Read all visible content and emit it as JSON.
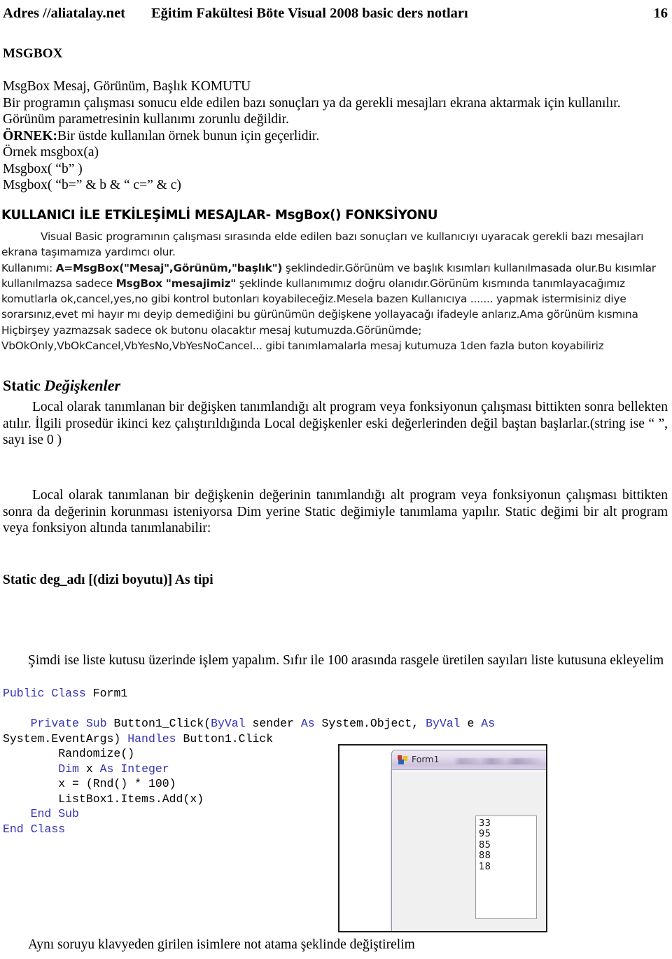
{
  "header": {
    "address": "Adres //aliatalay.net",
    "title": "Eğitim Fakültesi Böte Visual 2008 basic ders notları",
    "page_number": "16"
  },
  "msgbox_section": {
    "heading": "MSGBOX",
    "line1": "MsgBox Mesaj, Görünüm, Başlık KOMUTU",
    "line2": "Bir programın çalışması sonucu elde edilen bazı sonuçları ya da gerekli mesajları ekrana aktarmak için kullanılır.",
    "line3": "Görünüm parametresinin kullanımı zorunlu değildir.",
    "line4_bold": "ÖRNEK:",
    "line4_rest": "Bir üstde kullanılan örnek bunun için geçerlidir.",
    "line5": "Örnek msgbox(a)",
    "line6": "Msgbox( “b” )",
    "line7": "Msgbox( “b=” & b & “  c=” & c)"
  },
  "kullanici_section": {
    "heading": "KULLANICI İLE ETKİLEŞİMLİ MESAJLAR- MsgBox() FONKSİYONU",
    "p1": "Visual Basic programının çalışması sırasında elde edilen bazı sonuçları ve kullanıcıyı uyaracak gerekli bazı mesajları ekrana taşımamıza yardımcı olur.",
    "p2_pre": "Kullanımı: ",
    "p2_bold": "A=MsgBox(\"Mesaj\",Görünüm,\"başlık\")",
    "p2_mid": " şeklindedir.Görünüm ve başlık kısımları kullanılmasada olur.Bu kısımlar kullanılmazsa sadece ",
    "p2_bold2": "MsgBox \"mesajimiz\"",
    "p2_post": " şeklinde kullanımımız doğru olanıdır.Görünüm kısmında tanımlayacağımız komutlarla ok,cancel,yes,no gibi kontrol butonları koyabileceğiz.Mesela bazen Kullanıcıya ....... yapmak istermisiniz diye sorarsınız,evet mi hayır mı deyip demediğini bu gürünümün değişkene yollayacağı ifadeyle anlarız.Ama görünüm kısmına Hiçbirşey yazmazsak sadece ok butonu olacaktır mesaj kutumuzda.Görünümde; VbOkOnly,VbOkCancel,VbYesNo,VbYesNoCancel... gibi tanımlamalarla mesaj kutumuza 1den fazla buton koyabiliriz"
  },
  "static_section": {
    "heading_bold": "Static",
    "heading_italic": " Değişkenler",
    "p1": "Local olarak tanımlanan bir değişken tanımlandığı alt program veya fonksiyonun çalışması bittikten sonra bellekten atılır. İlgili prosedür ikinci kez çalıştırıldığında Local değişkenler eski değerlerinden değil baştan başlarlar.(string ise “ ”, sayı ise 0 )",
    "p2": "Local olarak tanımlanan bir değişkenin değerinin tanımlandığı alt program veya fonksiyonun çalışması bittikten sonra da değerinin korunması isteniyorsa Dim yerine Static değimiyle tanımlama yapılır. Static değimi bir alt program veya fonksiyon altında tanımlanabilir:",
    "syntax": "Static deg_adı [(dizi boyutu)] As tipi"
  },
  "liste_section": {
    "p1": "Şimdi ise liste kutusu üzerinde işlem yapalım.  Sıfır ile 100 arasında rasgele üretilen sayıları liste kutusuna ekleyelim"
  },
  "code": {
    "lines": [
      [
        {
          "t": "Public",
          "c": "kw"
        },
        {
          "t": " ",
          "c": ""
        },
        {
          "t": "Class",
          "c": "kw"
        },
        {
          "t": " Form1",
          "c": ""
        }
      ],
      [
        {
          "t": "",
          "c": ""
        }
      ],
      [
        {
          "t": "    ",
          "c": ""
        },
        {
          "t": "Private",
          "c": "kw"
        },
        {
          "t": " ",
          "c": ""
        },
        {
          "t": "Sub",
          "c": "kw"
        },
        {
          "t": " Button1_Click(",
          "c": ""
        },
        {
          "t": "ByVal",
          "c": "kw"
        },
        {
          "t": " sender ",
          "c": ""
        },
        {
          "t": "As",
          "c": "kw"
        },
        {
          "t": " System.Object, ",
          "c": ""
        },
        {
          "t": "ByVal",
          "c": "kw"
        },
        {
          "t": " e ",
          "c": ""
        },
        {
          "t": "As",
          "c": "kw"
        },
        {
          "t": " System.EventArgs) ",
          "c": ""
        },
        {
          "t": "Handles",
          "c": "kw"
        },
        {
          "t": " Button1.Click",
          "c": ""
        }
      ],
      [
        {
          "t": "        Randomize()",
          "c": ""
        }
      ],
      [
        {
          "t": "        ",
          "c": ""
        },
        {
          "t": "Dim",
          "c": "kw"
        },
        {
          "t": " x ",
          "c": ""
        },
        {
          "t": "As",
          "c": "kw"
        },
        {
          "t": " ",
          "c": ""
        },
        {
          "t": "Integer",
          "c": "kw"
        }
      ],
      [
        {
          "t": "        x = (Rnd() * 100)",
          "c": ""
        }
      ],
      [
        {
          "t": "        ListBox1.Items.Add(x)",
          "c": ""
        }
      ],
      [
        {
          "t": "    ",
          "c": ""
        },
        {
          "t": "End",
          "c": "kw"
        },
        {
          "t": " ",
          "c": ""
        },
        {
          "t": "Sub",
          "c": "kw"
        }
      ],
      [
        {
          "t": "End",
          "c": "kw"
        },
        {
          "t": " ",
          "c": ""
        },
        {
          "t": "Class",
          "c": "kw"
        }
      ]
    ]
  },
  "screenshot": {
    "form_caption": "Form1",
    "listbox_items": [
      "33",
      "95",
      "85",
      "88",
      "18"
    ],
    "icon": "vb-form-icon",
    "button_label": ""
  },
  "footer": {
    "p1": "Aynı soruyu klavyeden girilen isimlere not atama şeklinde değiştirelim"
  },
  "colors": {
    "code_keyword": "#3232b4",
    "text": "#000000",
    "form_titlebar": "#d8cfe4",
    "form_button": "#bee6fd"
  }
}
